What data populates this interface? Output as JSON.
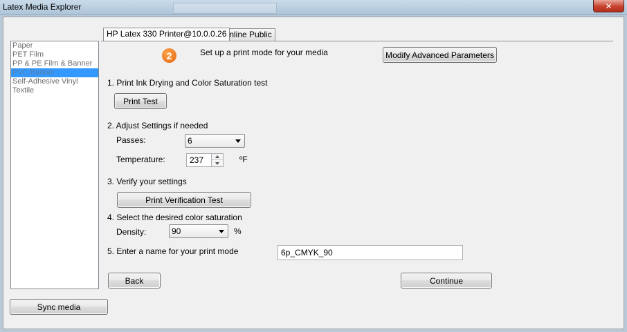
{
  "window": {
    "title": "Latex Media Explorer",
    "close_glyph": "✕"
  },
  "media_list": {
    "items": [
      {
        "label": "Paper"
      },
      {
        "label": "PET Film"
      },
      {
        "label": "PP & PE Film & Banner"
      },
      {
        "label": "PVC Banner",
        "selected": true
      },
      {
        "label": "Self-Adhesive Vinyl"
      },
      {
        "label": "Textile"
      }
    ]
  },
  "tabs": [
    {
      "label": "HP Latex 330 Printer@10.0.0.26",
      "active": true
    },
    {
      "label": "Online Public",
      "active": false
    }
  ],
  "header": {
    "step_number": "2",
    "instruction": "Set up a print mode for your media",
    "modify_button": "Modify Advanced Parameters"
  },
  "step1": {
    "title": "1. Print Ink Drying and Color Saturation test",
    "button": "Print Test"
  },
  "step2": {
    "title": "2. Adjust Settings if needed",
    "passes_label": "Passes:",
    "passes_value": "6",
    "temperature_label": "Temperature:",
    "temperature_value": "237",
    "temperature_unit": "ºF"
  },
  "step3": {
    "title": "3. Verify your settings",
    "button": "Print Verification Test"
  },
  "step4": {
    "title": "4. Select the desired color saturation",
    "density_label": "Density:",
    "density_value": "90",
    "density_unit": "%"
  },
  "step5": {
    "title": "5. Enter a name for your print mode",
    "name_value": "6p_CMYK_90"
  },
  "footer": {
    "back_button": "Back",
    "continue_button": "Continue",
    "sync_button": "Sync media"
  },
  "colors": {
    "selection": "#3399ff",
    "step_badge": "#f07a1a",
    "close_button": "#c7432f"
  }
}
